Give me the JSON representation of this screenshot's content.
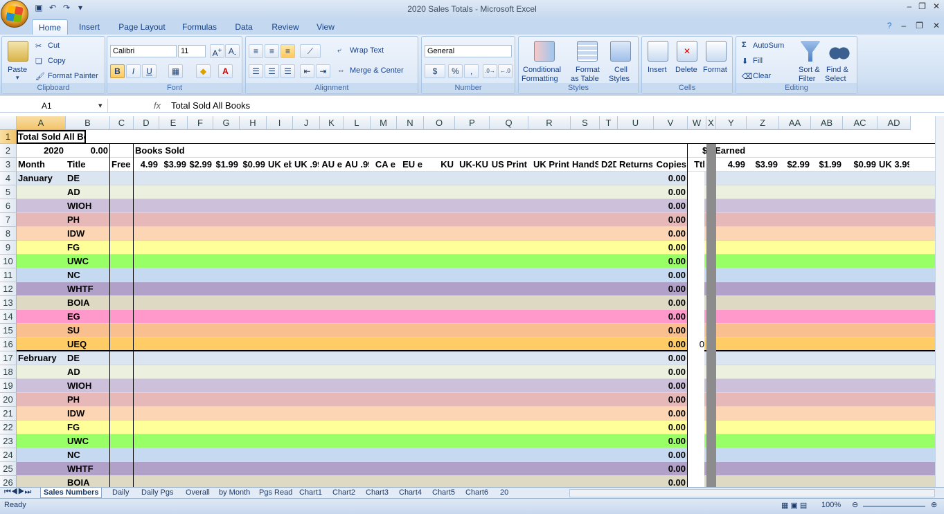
{
  "window": {
    "title": "2020 Sales Totals - Microsoft Excel"
  },
  "ribbon_tabs": [
    "Home",
    "Insert",
    "Page Layout",
    "Formulas",
    "Data",
    "Review",
    "View"
  ],
  "clipboard": {
    "paste": "Paste",
    "cut": "Cut",
    "copy": "Copy",
    "format_painter": "Format Painter",
    "title": "Clipboard"
  },
  "font": {
    "name": "Calibri",
    "size": "11",
    "title": "Font",
    "bold": "B",
    "italic": "I",
    "underline": "U"
  },
  "alignment": {
    "wrap": "Wrap Text",
    "merge": "Merge & Center",
    "title": "Alignment"
  },
  "number": {
    "format": "General",
    "currency": "$",
    "percent": "%",
    "comma": ",",
    "title": "Number"
  },
  "styles": {
    "cond1": "Conditional",
    "cond2": "Formatting",
    "fat1": "Format",
    "fat2": "as Table",
    "cs1": "Cell",
    "cs2": "Styles",
    "title": "Styles"
  },
  "cells": {
    "insert": "Insert",
    "delete": "Delete",
    "format": "Format",
    "title": "Cells"
  },
  "editing": {
    "autosum": "AutoSum",
    "fill": "Fill",
    "clear": "Clear",
    "sort1": "Sort &",
    "sort2": "Filter",
    "find1": "Find &",
    "find2": "Select",
    "title": "Editing"
  },
  "formula": {
    "cell_ref": "A1",
    "fx": "fx",
    "content": "Total Sold All Books"
  },
  "columns": [
    "A",
    "B",
    "C",
    "D",
    "E",
    "F",
    "G",
    "H",
    "I",
    "J",
    "K",
    "L",
    "M",
    "N",
    "O",
    "P",
    "Q",
    "R",
    "S",
    "T",
    "U",
    "V",
    "W",
    "X",
    "Y",
    "Z",
    "AA",
    "AB",
    "AC",
    "AD"
  ],
  "header_rows": {
    "r1": {
      "a": "Total Sold All Books"
    },
    "r2": {
      "a": "2020",
      "b": "0.00",
      "d": "Books Sold",
      "y": "$$ Earned"
    },
    "r3": [
      "Month",
      "Title",
      "Free",
      "4.99",
      "$3.99",
      "$2.99",
      "$1.99",
      "$0.99",
      "UK eb",
      "UK .99",
      "AU e",
      "AU .99",
      "CA e",
      "EU e",
      "KU",
      "UK-KU",
      "US Print",
      "UK Print",
      "HandSo",
      "D2D",
      "Returns",
      "Copies",
      "Ttl",
      "",
      "4.99",
      "$3.99",
      "$2.99",
      "$1.99",
      "$0.99",
      "UK 3.99"
    ]
  },
  "data_rows": [
    {
      "n": "4",
      "month": "January",
      "title": "DE",
      "copies": "0.00",
      "ttl": "",
      "color": "#dbe5f1"
    },
    {
      "n": "5",
      "month": "",
      "title": "AD",
      "copies": "0.00",
      "ttl": "",
      "color": "#ebf1de"
    },
    {
      "n": "6",
      "month": "",
      "title": "WIOH",
      "copies": "0.00",
      "ttl": "",
      "color": "#ccc0da"
    },
    {
      "n": "7",
      "month": "",
      "title": "PH",
      "copies": "0.00",
      "ttl": "",
      "color": "#e6b9b8"
    },
    {
      "n": "8",
      "month": "",
      "title": "IDW",
      "copies": "0.00",
      "ttl": "",
      "color": "#fcd5b4"
    },
    {
      "n": "9",
      "month": "",
      "title": "FG",
      "copies": "0.00",
      "ttl": "",
      "color": "#ffff99"
    },
    {
      "n": "10",
      "month": "",
      "title": "UWC",
      "copies": "0.00",
      "ttl": "",
      "color": "#99ff66"
    },
    {
      "n": "11",
      "month": "",
      "title": "NC",
      "copies": "0.00",
      "ttl": "",
      "color": "#c5d9f1"
    },
    {
      "n": "12",
      "month": "",
      "title": "WHTF",
      "copies": "0.00",
      "ttl": "",
      "color": "#b1a0c7"
    },
    {
      "n": "13",
      "month": "",
      "title": "BOIA",
      "copies": "0.00",
      "ttl": "",
      "color": "#ddd9c3"
    },
    {
      "n": "14",
      "month": "",
      "title": "EG",
      "copies": "0.00",
      "ttl": "",
      "color": "#ff99cc"
    },
    {
      "n": "15",
      "month": "",
      "title": "SU",
      "copies": "0.00",
      "ttl": "",
      "color": "#fabf8f"
    },
    {
      "n": "16",
      "month": "",
      "title": "UEQ",
      "copies": "0.00",
      "ttl": "0",
      "color": "#ffcc66"
    },
    {
      "n": "17",
      "month": "February",
      "title": "DE",
      "copies": "0.00",
      "ttl": "",
      "color": "#dbe5f1"
    },
    {
      "n": "18",
      "month": "",
      "title": "AD",
      "copies": "0.00",
      "ttl": "",
      "color": "#ebf1de"
    },
    {
      "n": "19",
      "month": "",
      "title": "WIOH",
      "copies": "0.00",
      "ttl": "",
      "color": "#ccc0da"
    },
    {
      "n": "20",
      "month": "",
      "title": "PH",
      "copies": "0.00",
      "ttl": "",
      "color": "#e6b9b8"
    },
    {
      "n": "21",
      "month": "",
      "title": "IDW",
      "copies": "0.00",
      "ttl": "",
      "color": "#fcd5b4"
    },
    {
      "n": "22",
      "month": "",
      "title": "FG",
      "copies": "0.00",
      "ttl": "",
      "color": "#ffff99"
    },
    {
      "n": "23",
      "month": "",
      "title": "UWC",
      "copies": "0.00",
      "ttl": "",
      "color": "#99ff66"
    },
    {
      "n": "24",
      "month": "",
      "title": "NC",
      "copies": "0.00",
      "ttl": "",
      "color": "#c5d9f1"
    },
    {
      "n": "25",
      "month": "",
      "title": "WHTF",
      "copies": "0.00",
      "ttl": "",
      "color": "#b1a0c7"
    },
    {
      "n": "26",
      "month": "",
      "title": "BOIA",
      "copies": "0.00",
      "ttl": "",
      "color": "#ddd9c3"
    }
  ],
  "sheet_tabs": [
    "Sales Numbers",
    "Daily",
    "Daily Pgs",
    "Overall",
    "by Month",
    "Pgs Read",
    "Chart1",
    "Chart2",
    "Chart3",
    "Chart4",
    "Chart5",
    "Chart6",
    "20"
  ],
  "status": {
    "ready": "Ready",
    "zoom": "100%"
  }
}
